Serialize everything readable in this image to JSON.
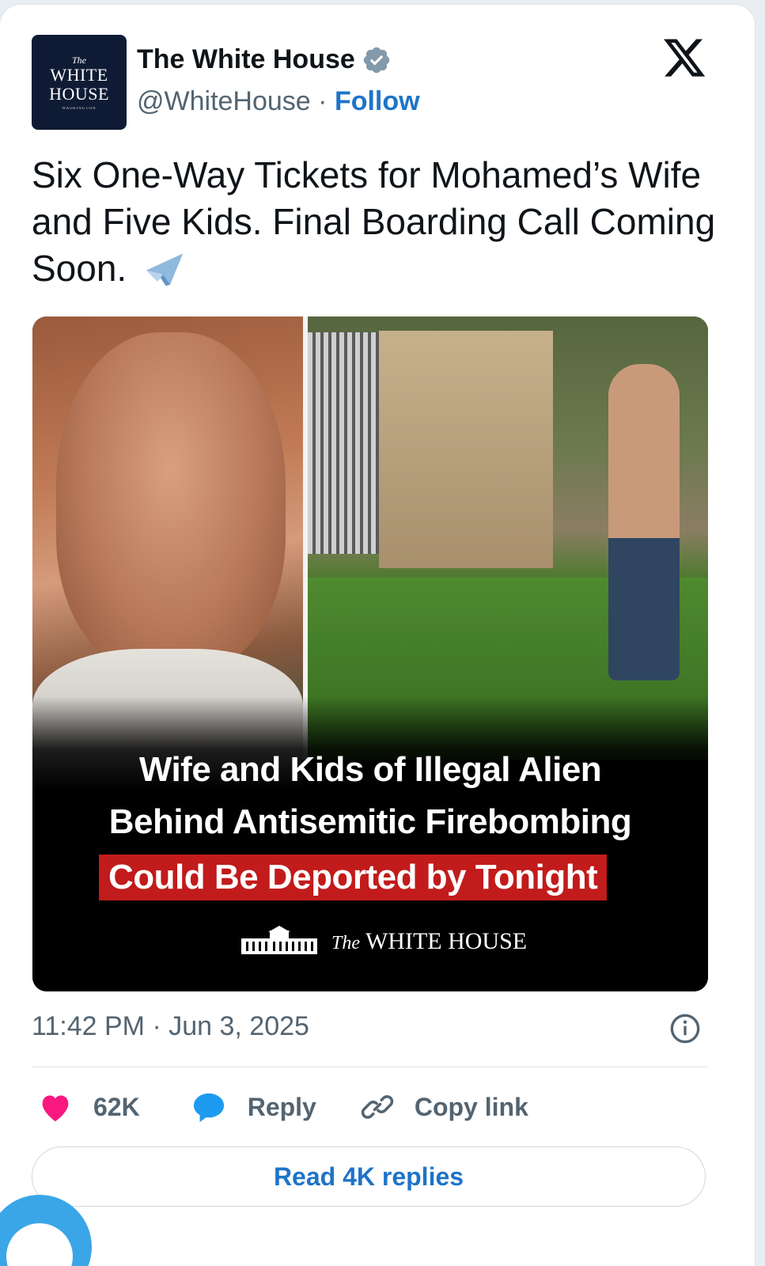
{
  "account": {
    "avatar_lines": [
      "The",
      "WHITE",
      "HOUSE",
      "WASHINGTON"
    ],
    "display_name": "The White House",
    "verified_icon": "verified-badge-icon",
    "handle": "@WhiteHouse",
    "separator": "·",
    "follow_label": "Follow"
  },
  "platform_icon": "x-logo-icon",
  "tweet": {
    "text": "Six One-Way Tickets for Mohamed’s Wife and Five Kids. Final Boarding Call Coming Soon.",
    "emoji_icon": "airplane-icon"
  },
  "media": {
    "headline_line1": "Wife and Kids of Illegal Alien",
    "headline_line2": "Behind Antisemitic Firebombing",
    "headline_line3": "Could Be Deported by Tonight",
    "brand_the": "The",
    "brand_name": "WHITE HOUSE",
    "highlight_color": "#c21b1b"
  },
  "meta": {
    "timestamp": "11:42 PM · Jun 3, 2025",
    "info_icon": "info-icon"
  },
  "actions": {
    "like_count": "62K",
    "reply_label": "Reply",
    "copy_label": "Copy link"
  },
  "read_replies_label": "Read 4K replies",
  "colors": {
    "link_blue": "#1d74c8",
    "like_pink": "#f91880",
    "reply_blue": "#1d9bf0",
    "text_primary": "#0f1419",
    "text_secondary": "#536471"
  }
}
